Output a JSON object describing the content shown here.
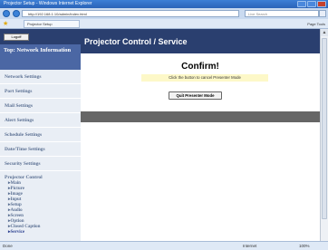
{
  "browser": {
    "window_title": "Projector Setup - Windows Internet Explorer",
    "address": "http://192.168.1.10/admin/index.html",
    "search_placeholder": "Live Search",
    "favorites_tab": "Projector Setup",
    "tools_text": "Page  Tools",
    "status_left": "Done",
    "status_zone": "Internet",
    "status_zoom": "100%"
  },
  "sidebar": {
    "logout_label": "Logoff",
    "top_label": "Top: Network Information",
    "items": [
      "Network Settings",
      "Port Settings",
      "Mail Settings",
      "Alert Settings",
      "Schedule Settings",
      "Date/Time Settings",
      "Security Settings"
    ],
    "group_title": "Projector Control",
    "sub_items": [
      "Main",
      "Picture",
      "Image",
      "Input",
      "Setup",
      "Audio",
      "Screen",
      "Option",
      "Closed Caption",
      "Service"
    ]
  },
  "main": {
    "header": "Projector Control / Service",
    "confirm_title": "Confirm!",
    "confirm_message": "Click the button to cancel Presenter Mode",
    "quit_button": "Quit Presenter Mode"
  }
}
